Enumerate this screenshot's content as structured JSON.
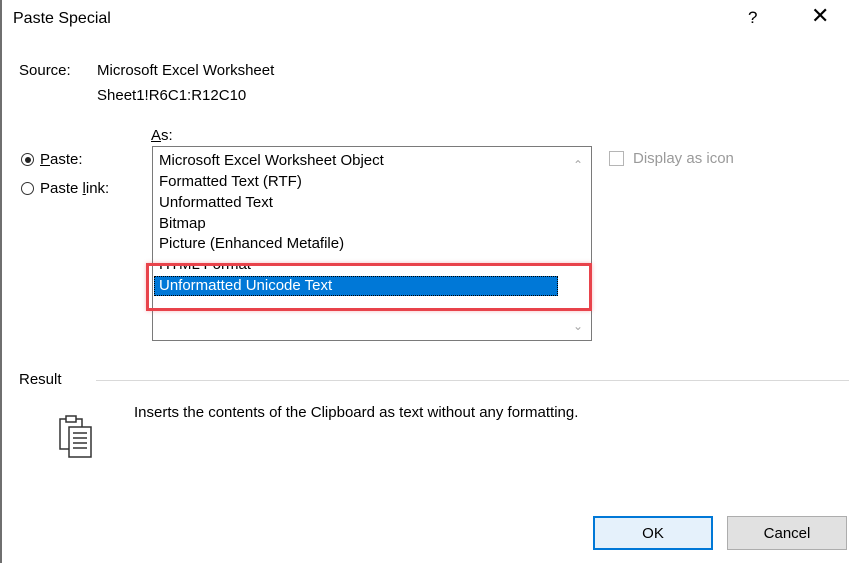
{
  "window": {
    "title": "Paste Special",
    "help_label": "?",
    "close_label": "✕"
  },
  "source": {
    "label": "Source:",
    "value": "Microsoft Excel Worksheet",
    "range": "Sheet1!R6C1:R12C10"
  },
  "as_label": {
    "pre": "",
    "key": "A",
    "post": "s:"
  },
  "options": {
    "paste": {
      "key": "P",
      "rest": "aste:",
      "checked": true
    },
    "paste_link": {
      "pre": "Paste ",
      "key": "l",
      "post": "ink:",
      "checked": false
    }
  },
  "formats": {
    "items": [
      "Microsoft Excel Worksheet Object",
      "Formatted Text (RTF)",
      "Unformatted Text",
      "Bitmap",
      "Picture (Enhanced Metafile)",
      "HTML Format",
      "Unformatted Unicode Text"
    ],
    "selected": "Unformatted Unicode Text"
  },
  "display_as_icon": {
    "label": "Display as icon",
    "checked": false,
    "enabled": false
  },
  "result": {
    "label": "Result",
    "description": "Inserts the contents of the Clipboard as text without any formatting.",
    "icon": "clipboard-text-icon"
  },
  "buttons": {
    "ok": "OK",
    "cancel": "Cancel"
  },
  "colors": {
    "selection": "#0078d7",
    "highlight_box": "#e8434b"
  }
}
